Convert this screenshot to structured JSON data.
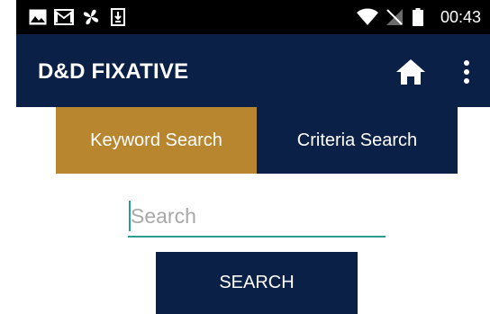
{
  "status_bar": {
    "time": "00:43",
    "icons": [
      "image-icon",
      "mail-icon",
      "fan-icon",
      "download-icon",
      "wifi-icon",
      "no-signal-icon",
      "battery-icon"
    ]
  },
  "app_bar": {
    "title": "D&D FIXATIVE",
    "icons": [
      "home-icon",
      "more-vert-icon"
    ]
  },
  "tabs": [
    {
      "label": "Keyword Search",
      "active": true
    },
    {
      "label": "Criteria Search",
      "active": false
    }
  ],
  "search": {
    "placeholder": "Search",
    "value": "",
    "button_label": "SEARCH"
  },
  "colors": {
    "primary": "#0b2046",
    "accent": "#b8862f",
    "input_underline": "#2a9d8f"
  }
}
